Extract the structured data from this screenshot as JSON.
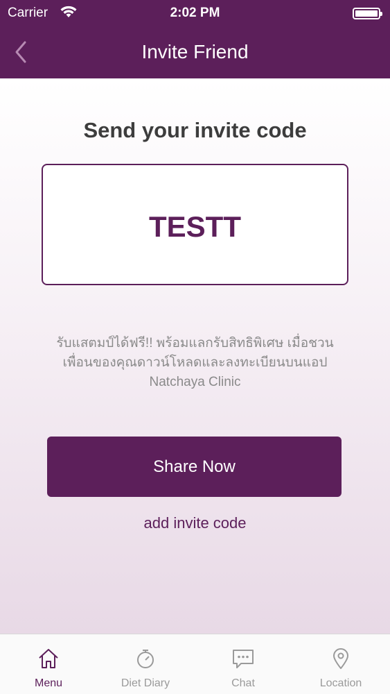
{
  "status_bar": {
    "carrier": "Carrier",
    "time": "2:02 PM"
  },
  "nav": {
    "title": "Invite Friend",
    "back_icon": "chevron-left-icon"
  },
  "main": {
    "heading": "Send your invite code",
    "invite_code": "TESTT",
    "description": "รับแสตมป์ได้ฟรี!! พร้อมแลกรับสิทธิพิเศษ เมื่อชวนเพื่อนของคุณดาวน์โหลดและลงทะเบียนบนแอป Natchaya Clinic",
    "share_button": "Share Now",
    "add_code_link": "add invite code"
  },
  "tabs": [
    {
      "label": "Menu",
      "icon": "home-icon",
      "active": true
    },
    {
      "label": "Diet Diary",
      "icon": "stopwatch-icon",
      "active": false
    },
    {
      "label": "Chat",
      "icon": "chat-bubble-icon",
      "active": false
    },
    {
      "label": "Location",
      "icon": "location-pin-icon",
      "active": false
    }
  ],
  "colors": {
    "brand": "#5c1f5a",
    "inactive_tab": "#9a9a9a"
  }
}
